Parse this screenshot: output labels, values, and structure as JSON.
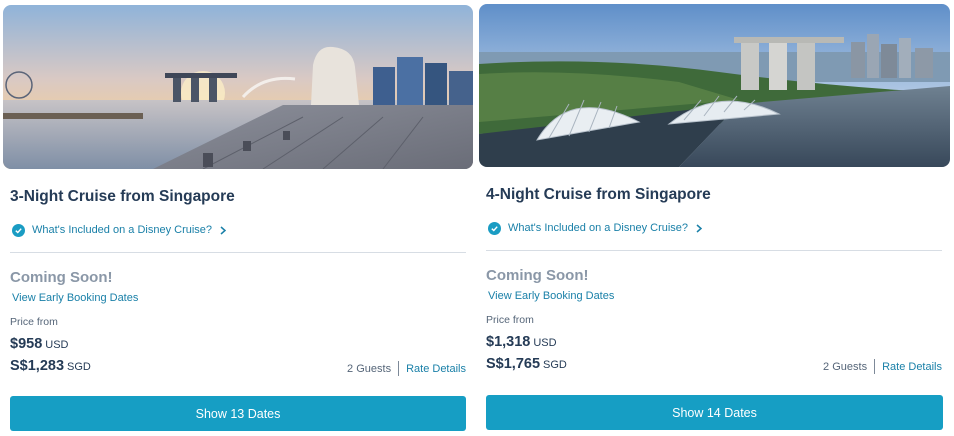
{
  "cards": [
    {
      "title": "3-Night Cruise from Singapore",
      "included_link": "What's Included on a Disney Cruise?",
      "status": "Coming Soon!",
      "early_link": "View Early Booking Dates",
      "price_from_label": "Price from",
      "price_usd": "$958",
      "price_usd_unit": "USD",
      "price_sgd": "S$1,283",
      "price_sgd_unit": "SGD",
      "guests": "2 Guests",
      "rate_link": "Rate Details",
      "button": "Show 13 Dates"
    },
    {
      "title": "4-Night Cruise from Singapore",
      "included_link": "What's Included on a Disney Cruise?",
      "status": "Coming Soon!",
      "early_link": "View Early Booking Dates",
      "price_from_label": "Price from",
      "price_usd": "$1,318",
      "price_usd_unit": "USD",
      "price_sgd": "S$1,765",
      "price_sgd_unit": "SGD",
      "guests": "2 Guests",
      "rate_link": "Rate Details",
      "button": "Show 14 Dates"
    }
  ],
  "colors": {
    "accent": "#169ec4",
    "link": "#1a80a8",
    "title": "#253b56",
    "muted": "#8a97a7"
  },
  "icons": [
    "check-circle-icon",
    "chevron-right-icon"
  ]
}
